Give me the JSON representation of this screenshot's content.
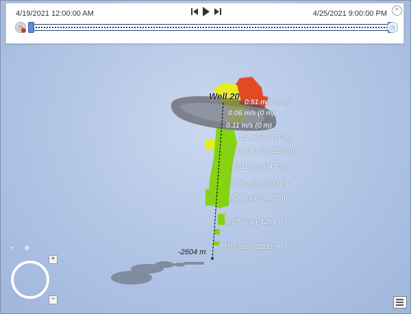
{
  "time_slider": {
    "start_time": "4/19/2021 12:00:00 AM",
    "end_time": "4/25/2021 9:00:00 PM",
    "controls": {
      "previous_icon": "skip-previous-icon",
      "play_icon": "play-icon",
      "next_icon": "skip-next-icon",
      "collapse_icon": "chevron-up-icon"
    },
    "left_icon": "clock-disabled-icon",
    "right_icon": "clock-icon",
    "track_color": "#1f3d6b",
    "thumb_color": "#5b8fd6"
  },
  "scene": {
    "well_label": "Well 20",
    "depth_label": "-2604 m",
    "velocity_labels": [
      "0.51 m/s (0 m)",
      "0.06 m/s (0 m)",
      "0.11 m/s (0 m)",
      "0.1 m/s (-150 m)",
      "0.07 m/s (-250 m)",
      "0.11 m/s (-400 m)",
      "0.06 m/s (-600 m)",
      "0.06 m/s (-800 m)",
      "0.07 m/s (-1250 m)",
      "0.07 m/s (-2000 m)"
    ],
    "colors": {
      "high": "#e24a26",
      "medium": "#e6ec1e",
      "low": "#86d313",
      "ring": "#4e4a4a",
      "shadow": "#6d7683"
    }
  },
  "navigator": {
    "zoom_in": "+",
    "zoom_out": "−"
  },
  "layer_list_icon": "layer-list-icon"
}
